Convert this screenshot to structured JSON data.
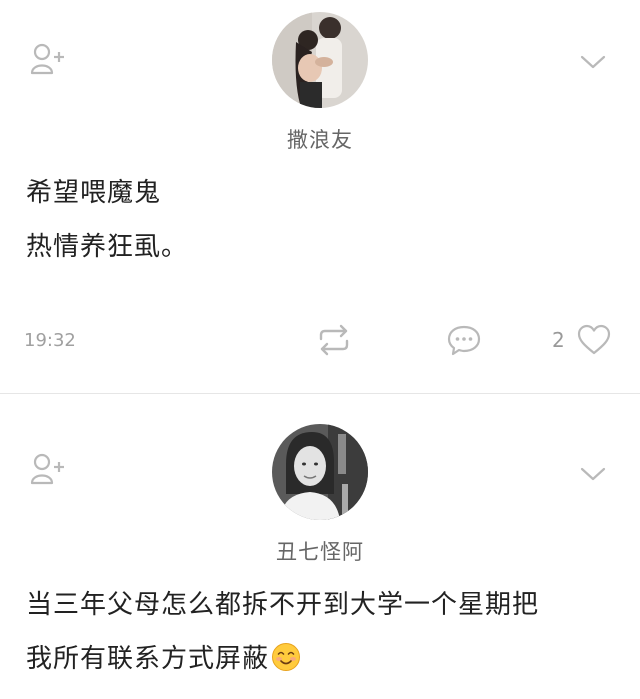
{
  "colors": {
    "icon_gray": "#b9b9b9",
    "text_gray": "#999999",
    "divider": "#e6e6e6"
  },
  "icons": [
    "add-friend-icon",
    "chevron-down-icon",
    "repost-icon",
    "comment-icon",
    "heart-icon",
    "smile-emoji-icon"
  ],
  "posts": [
    {
      "username": "撒浪友",
      "content": [
        "希望喂魔鬼",
        "热情养狂虱。"
      ],
      "time": "19:32",
      "likes": "2"
    },
    {
      "username": "丑七怪阿",
      "content": [
        "当三年父母怎么都拆不开到大学一个星期把",
        "我所有联系方式屏蔽"
      ]
    }
  ]
}
